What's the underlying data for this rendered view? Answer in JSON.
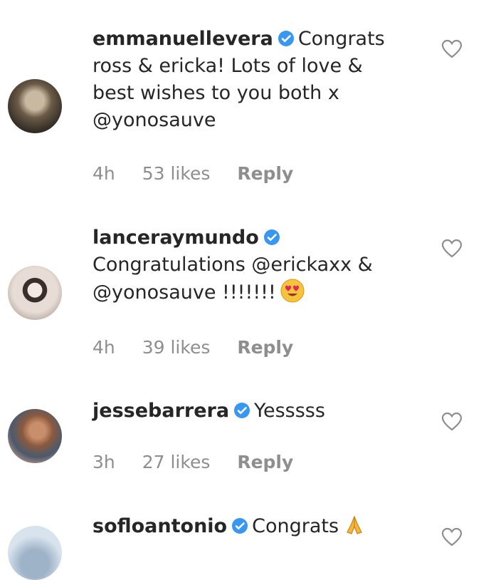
{
  "comments": [
    {
      "username": "emmanuellevera",
      "text_lines": [
        "Congrats",
        "ross & ericka! Lots of love &",
        "best wishes to you both x",
        "@yonosauve"
      ],
      "time": "4h",
      "likes": "53 likes",
      "reply": "Reply"
    },
    {
      "username": "lanceraymundo",
      "text_lines": [
        "Congratulations @erickaxx &",
        "@yonosauve !!!!!!!"
      ],
      "emoji": "heart-eyes-emoji",
      "time": "4h",
      "likes": "39 likes",
      "reply": "Reply"
    },
    {
      "username": "jessebarrera",
      "text_lines": [
        "Yesssss"
      ],
      "time": "3h",
      "likes": "27 likes",
      "reply": "Reply"
    },
    {
      "username": "sofloantonio",
      "text_lines": [
        "Congrats"
      ],
      "emoji": "folded-hands-emoji"
    }
  ],
  "icons": {
    "verified": "verified-badge-icon",
    "like": "heart-outline-icon"
  },
  "colors": {
    "verified": "#3897f0",
    "meta": "#8e8e8e",
    "text": "#262626"
  }
}
